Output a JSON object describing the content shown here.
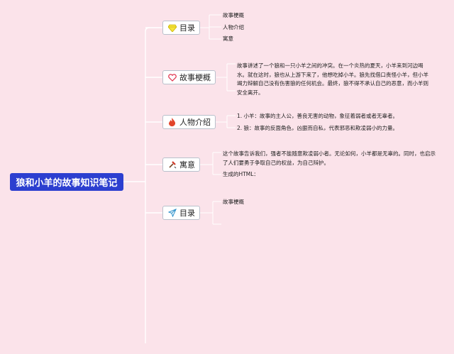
{
  "root": {
    "title": "狼和小羊的故事知识笔记"
  },
  "branches": [
    {
      "label": "目录",
      "icon": "gem-icon",
      "items": [
        "故事梗概",
        "人物介绍",
        "寓意"
      ]
    },
    {
      "label": "故事梗概",
      "icon": "heart-icon",
      "text": "故事讲述了一个狼和一只小羊之间的冲突。在一个炎热的夏天，小羊来到河边喝水。就在这时，狼也从上游下来了，他想吃掉小羊。狼先找借口责怪小羊，但小羊竭力辩解自己没有伤害狼的任何机会。最终，狼不得不承认自己的恶意，而小羊则安全离开。"
    },
    {
      "label": "人物介绍",
      "icon": "flame-icon",
      "items": [
        "1. 小羊：故事的主人公，善良无害的动物，象征着弱者或者无辜者。",
        "2. 狼：故事的反面角色，凶狠而自私，代表邪恶和欺凌弱小的力量。"
      ]
    },
    {
      "label": "寓意",
      "icon": "tools-icon",
      "text": "这个故事告诉我们，强者不能随意欺凌弱小者。无论如何，小羊都是无辜的。同时，也启示了人们要勇于争取自己的权益，为自己辩护。",
      "extra": "生成的HTML："
    },
    {
      "label": "目录",
      "icon": "paper-plane-icon",
      "items": [
        "故事梗概"
      ]
    }
  ],
  "colors": {
    "root_bg": "#2c3fd0",
    "line": "#ffffff",
    "background": "#fbe3ea"
  }
}
